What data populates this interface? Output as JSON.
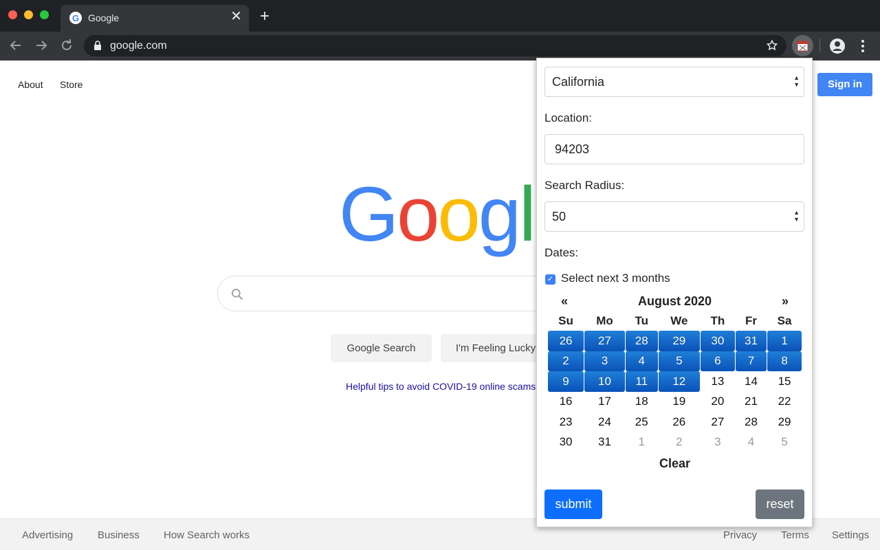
{
  "browser": {
    "tab_title": "Google",
    "url": "google.com"
  },
  "google": {
    "top_links": [
      "About",
      "Store"
    ],
    "sign_in": "Sign in",
    "logo_text": "Google",
    "search_button": "Google Search",
    "lucky_button": "I'm Feeling Lucky",
    "tips_link": "Helpful tips to avoid COVID-19 online scams",
    "footer_left": [
      "Advertising",
      "Business",
      "How Search works"
    ],
    "footer_right": [
      "Privacy",
      "Terms",
      "Settings"
    ]
  },
  "popup": {
    "state_select": "California",
    "location_label": "Location:",
    "location_value": "94203",
    "radius_label": "Search Radius:",
    "radius_value": "50",
    "dates_label": "Dates:",
    "select_next_label": "Select next 3 months",
    "select_next_checked": true,
    "calendar": {
      "prev": "«",
      "month": "August 2020",
      "next": "»",
      "weekdays": [
        "Su",
        "Mo",
        "Tu",
        "We",
        "Th",
        "Fr",
        "Sa"
      ],
      "weeks": [
        [
          "26",
          "27",
          "28",
          "29",
          "30",
          "31",
          "1"
        ],
        [
          "2",
          "3",
          "4",
          "5",
          "6",
          "7",
          "8"
        ],
        [
          "9",
          "10",
          "11",
          "12",
          "13",
          "14",
          "15"
        ],
        [
          "16",
          "17",
          "18",
          "19",
          "20",
          "21",
          "22"
        ],
        [
          "23",
          "24",
          "25",
          "26",
          "27",
          "28",
          "29"
        ],
        [
          "30",
          "31",
          "1",
          "2",
          "3",
          "4",
          "5"
        ]
      ],
      "selected": [
        [
          true,
          true,
          true,
          true,
          true,
          true,
          true
        ],
        [
          true,
          true,
          true,
          true,
          true,
          true,
          true
        ],
        [
          true,
          true,
          true,
          true,
          false,
          false,
          false
        ],
        [
          false,
          false,
          false,
          false,
          false,
          false,
          false
        ],
        [
          false,
          false,
          false,
          false,
          false,
          false,
          false
        ],
        [
          false,
          false,
          false,
          false,
          false,
          false,
          false
        ]
      ],
      "other_month": [
        [
          false,
          false,
          false,
          false,
          false,
          false,
          false
        ],
        [
          false,
          false,
          false,
          false,
          false,
          false,
          false
        ],
        [
          false,
          false,
          false,
          false,
          false,
          false,
          false
        ],
        [
          false,
          false,
          false,
          false,
          false,
          false,
          false
        ],
        [
          false,
          false,
          false,
          false,
          false,
          false,
          false
        ],
        [
          false,
          false,
          true,
          true,
          true,
          true,
          true
        ]
      ],
      "clear": "Clear"
    },
    "submit": "submit",
    "reset": "reset"
  },
  "colors": {
    "selected_day": "#0a52b8",
    "submit": "#0d6efd",
    "reset": "#6c757d",
    "sign_in": "#4285f4"
  }
}
